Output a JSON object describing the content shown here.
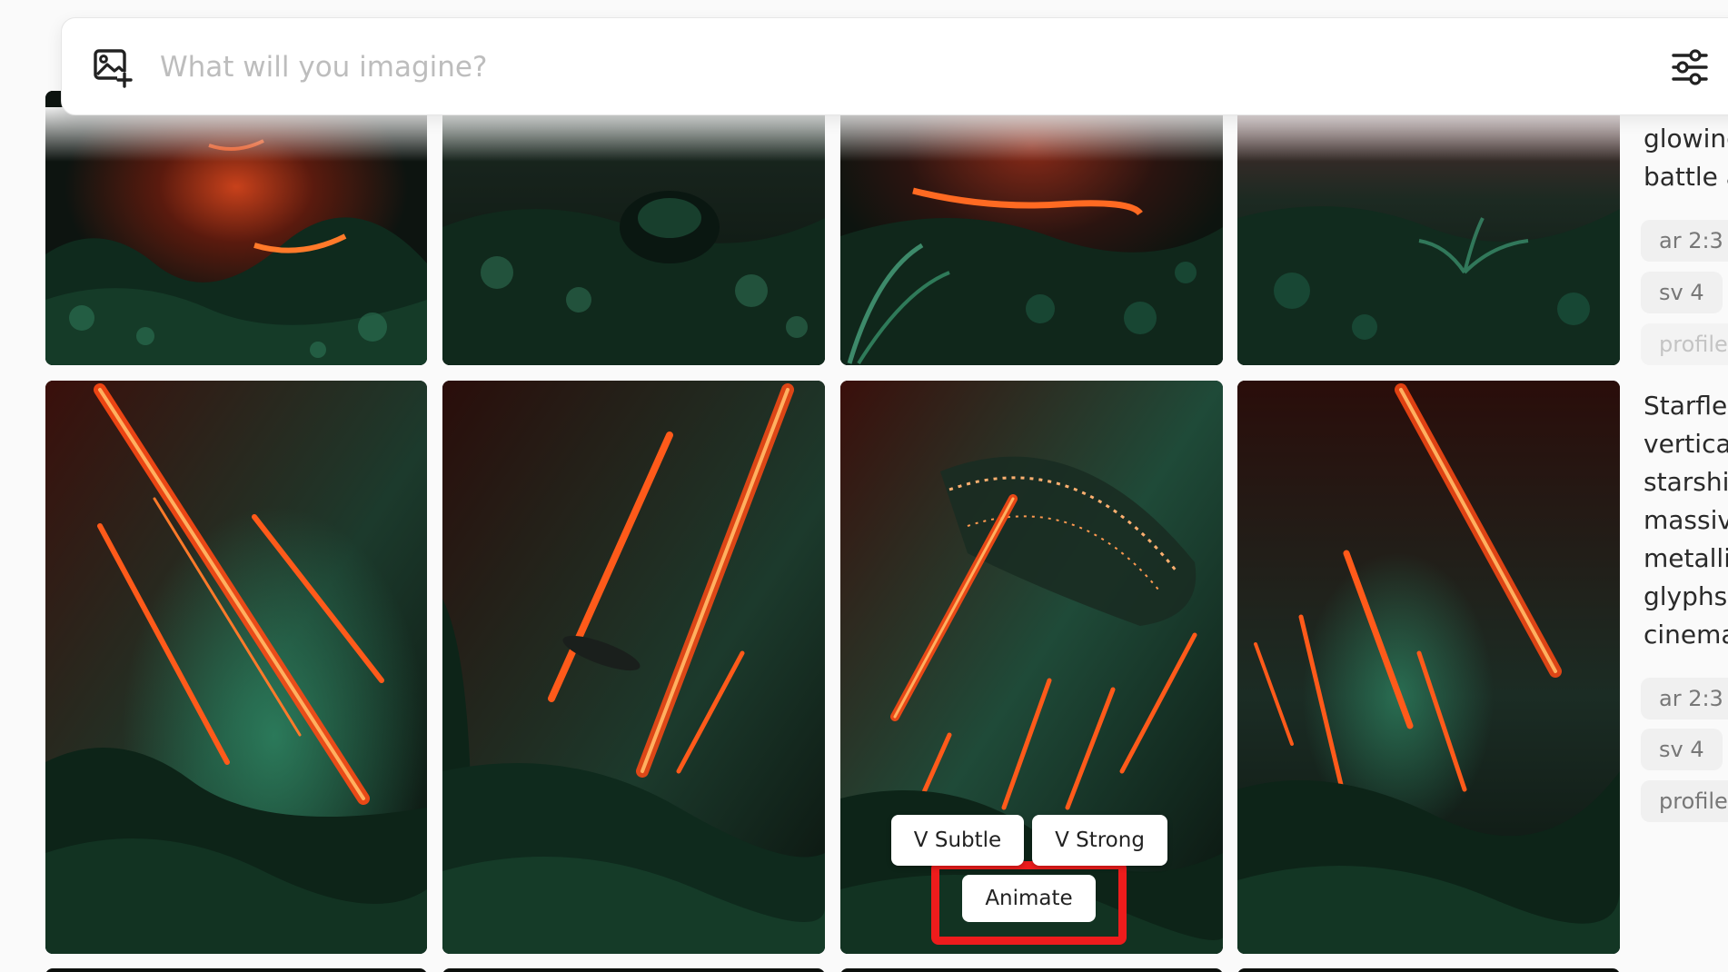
{
  "prompt_bar": {
    "placeholder": "What will you imagine?",
    "left_icon": "image-add-icon",
    "right_icon": "sliders-settings-icon"
  },
  "grid": {
    "top_row_images": [
      "glowing lava chasm in jungle",
      "dark jungle with strange pod",
      "jungle with glowing lava stream and ferns",
      "dense jungle foliage with pink haze"
    ],
    "bottom_row_images": [
      "falling burning starship streaks over jungle",
      "burning streaks and small ship over jungle",
      "massive alien ring starship over jungle with fire streaks",
      "fire streaks raining over jungle with green glow"
    ]
  },
  "hover_actions": {
    "v_subtle": "V Subtle",
    "v_strong": "V Strong",
    "animate": "Animate"
  },
  "right_panel": {
    "prompt1_lines": [
      "glowing",
      "battle a"
    ],
    "prompt1_chips": [
      "ar 2:3",
      "sv 4",
      "profile"
    ],
    "prompt2_lines": [
      "Starflee",
      "vertica",
      "starshi",
      "massiv",
      "metallic",
      "glyphs,",
      "cinema"
    ],
    "prompt2_chips": [
      "ar 2:3",
      "sv 4",
      "profile"
    ]
  },
  "colors": {
    "highlight": "#ee1c1c",
    "fire": "#ff5a1a",
    "jungle": "#1f6b4f"
  }
}
